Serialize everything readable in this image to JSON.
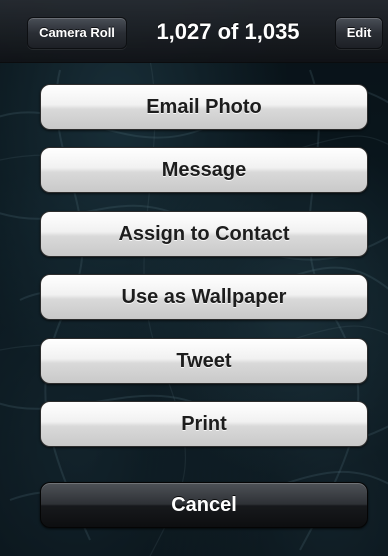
{
  "nav": {
    "back_label": "Camera Roll",
    "title": "1,027 of 1,035",
    "edit_label": "Edit"
  },
  "action_sheet": {
    "buttons": [
      {
        "label": "Email Photo"
      },
      {
        "label": "Message"
      },
      {
        "label": "Assign to Contact"
      },
      {
        "label": "Use as Wallpaper"
      },
      {
        "label": "Tweet"
      },
      {
        "label": "Print"
      }
    ],
    "cancel_label": "Cancel"
  },
  "colors": {
    "button_face": "#e6e6e6",
    "button_text": "#1d1d1d",
    "cancel_face": "#1a1c1f",
    "cancel_text": "#ffffff",
    "navbar": "#202328"
  }
}
